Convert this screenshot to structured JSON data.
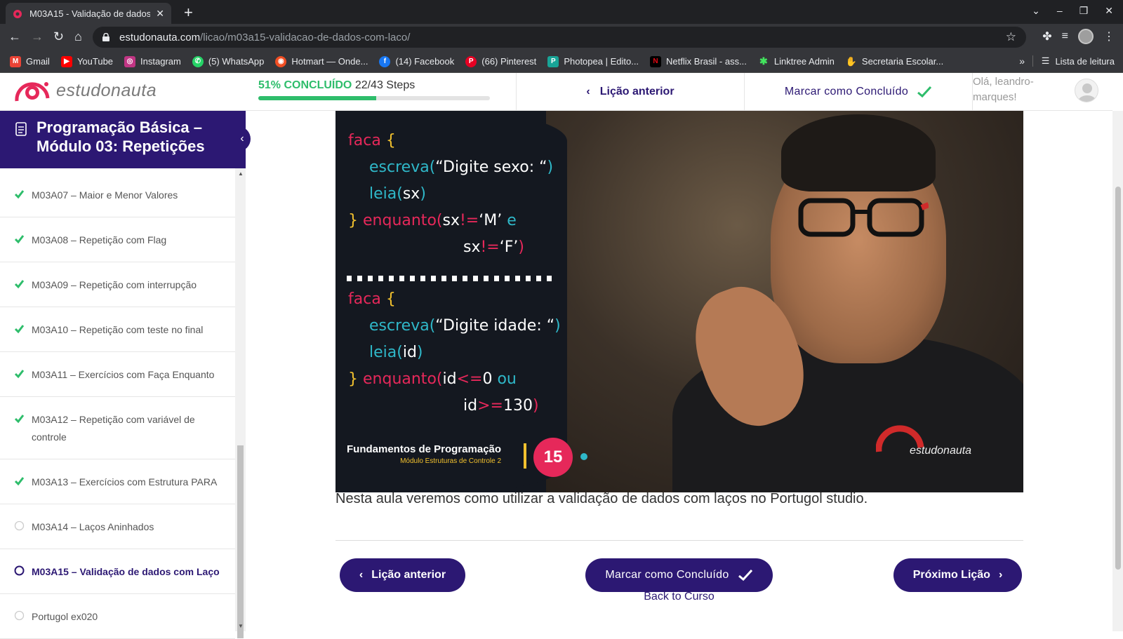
{
  "browser": {
    "tab_title": "M03A15 - Validação de dados",
    "tab_close": "✕",
    "new_tab": "+",
    "url_host": "estudonauta.com",
    "url_path": "/licao/m03a15-validacao-de-dados-com-laco/",
    "bookmarks": [
      {
        "label": "Gmail",
        "color": "#ea4335",
        "glyph": "M"
      },
      {
        "label": "YouTube",
        "color": "#ff0000",
        "glyph": "▶"
      },
      {
        "label": "Instagram",
        "color": "#c13584",
        "glyph": "◎"
      },
      {
        "label": "(5) WhatsApp",
        "color": "#25d366",
        "glyph": "✆"
      },
      {
        "label": "Hotmart — Onde...",
        "color": "#f04e23",
        "glyph": "◉"
      },
      {
        "label": "(14) Facebook",
        "color": "#1877f2",
        "glyph": "f"
      },
      {
        "label": "(66) Pinterest",
        "color": "#e60023",
        "glyph": "P"
      },
      {
        "label": "Photopea | Edito...",
        "color": "#18a497",
        "glyph": "P"
      },
      {
        "label": "Netflix Brasil - ass...",
        "color": "#e50914",
        "glyph": "N"
      },
      {
        "label": "Linktree Admin",
        "color": "#43e55e",
        "glyph": "✱"
      },
      {
        "label": "Secretaria Escolar...",
        "color": "#4a90e2",
        "glyph": "✋"
      }
    ],
    "more": "»",
    "reading_list": "Lista de leitura"
  },
  "header": {
    "logo": "estudonauta",
    "progress_pct_label": "51% CONCLUÍDO",
    "progress_steps": "22/43 Steps",
    "progress_fraction": 0.51,
    "prev_label": "Lição anterior",
    "mark_label": "Marcar como Concluído",
    "greeting": "Olá, leandro-marques!"
  },
  "sidebar": {
    "course_title": "Programação Básica – Módulo 03: Repetições",
    "lessons": [
      {
        "label": "M03A07 – Maior e Menor Valores",
        "status": "done"
      },
      {
        "label": "M03A08 – Repetição com Flag",
        "status": "done"
      },
      {
        "label": "M03A09 – Repetição com interrupção",
        "status": "done"
      },
      {
        "label": "M03A10 – Repetição com teste no final",
        "status": "done"
      },
      {
        "label": "M03A11 – Exercícios com Faça Enquanto",
        "status": "done"
      },
      {
        "label": "M03A12 – Repetição com variável de controle",
        "status": "done"
      },
      {
        "label": "M03A13 – Exercícios com Estrutura PARA",
        "status": "done"
      },
      {
        "label": "M03A14 – Laços Aninhados",
        "status": "todo"
      },
      {
        "label": "M03A15 – Validação de dados com Laço",
        "status": "current"
      },
      {
        "label": "Portugol ex020",
        "status": "todo"
      }
    ]
  },
  "video": {
    "code1_l1_kw": "faca",
    "code1_l1_br": "{",
    "code1_l2_fn": "escreva(",
    "code1_l2_str": "“Digite sexo: “",
    "code1_l2_end": ")",
    "code1_l3_fn": "leia(",
    "code1_l3_var": "sx",
    "code1_l3_end": ")",
    "code1_l4_br": "}",
    "code1_l4_kw": "enquanto(",
    "code1_l4_a": "sx",
    "code1_l4_op": "!=",
    "code1_l4_val": "‘M’",
    "code1_l4_e": "e",
    "code1_l5_a": "sx",
    "code1_l5_op": "!=",
    "code1_l5_val": "‘F’",
    "code1_l5_end": ")",
    "code2_l1_kw": "faca",
    "code2_l1_br": "{",
    "code2_l2_fn": "escreva(",
    "code2_l2_str": "“Digite idade: “",
    "code2_l2_end": ")",
    "code2_l3_fn": "leia(",
    "code2_l3_var": "id",
    "code2_l3_end": ")",
    "code2_l4_br": "}",
    "code2_l4_kw": "enquanto(",
    "code2_l4_a": "id",
    "code2_l4_op": "<=",
    "code2_l4_val": "0",
    "code2_l4_ou": "ou",
    "code2_l5_a": "id",
    "code2_l5_op": ">=",
    "code2_l5_val": "130",
    "code2_l5_end": ")",
    "footer_title": "Fundamentos de Programação",
    "footer_sub": "Módulo Estruturas de Controle 2",
    "episode": "15",
    "watermark": "estudonauta"
  },
  "content": {
    "description": "Nesta aula veremos como utilizar a validação de dados com laços no Portugol studio.",
    "prev_button": "Lição anterior",
    "mark_button": "Marcar como Concluído",
    "next_button": "Próximo Lição",
    "back_link": "Back to Curso"
  },
  "colors": {
    "brand": "#2c1873",
    "success": "#2ebd6b",
    "accent_red": "#e6285a",
    "accent_cyan": "#2fb8c9",
    "accent_yellow": "#f2c12e"
  }
}
